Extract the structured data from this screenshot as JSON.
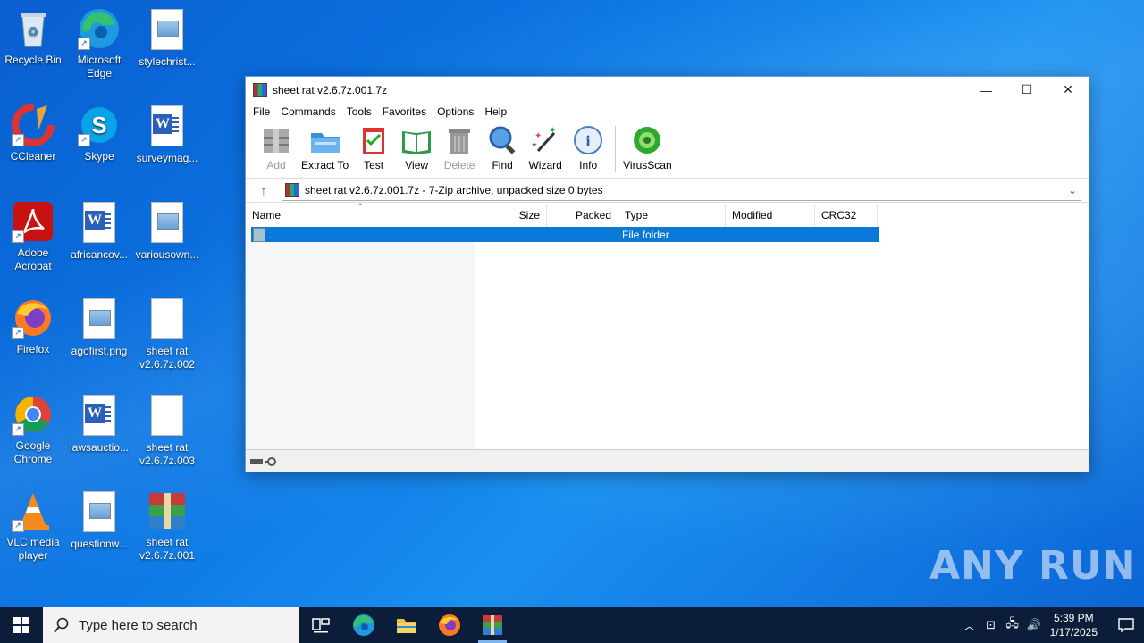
{
  "desktop": {
    "icons": [
      {
        "label": "Recycle Bin"
      },
      {
        "label": "Microsoft Edge"
      },
      {
        "label": "stylechrist..."
      },
      {
        "label": "CCleaner"
      },
      {
        "label": "Skype"
      },
      {
        "label": "surveymag..."
      },
      {
        "label": "Adobe Acrobat"
      },
      {
        "label": "africancov..."
      },
      {
        "label": "variousown..."
      },
      {
        "label": "Firefox"
      },
      {
        "label": "agofirst.png"
      },
      {
        "label": "sheet rat v2.6.7z.002"
      },
      {
        "label": "Google Chrome"
      },
      {
        "label": "lawsauctio..."
      },
      {
        "label": "sheet rat v2.6.7z.003"
      },
      {
        "label": "VLC media player"
      },
      {
        "label": "questionw..."
      },
      {
        "label": "sheet rat v2.6.7z.001"
      }
    ]
  },
  "window": {
    "title": "sheet rat v2.6.7z.001.7z",
    "minimize": "—",
    "maximize": "☐",
    "close": "✕",
    "menu": [
      "File",
      "Commands",
      "Tools",
      "Favorites",
      "Options",
      "Help"
    ],
    "toolbar": [
      {
        "label": "Add",
        "icon": "add-archive-icon",
        "disabled": true
      },
      {
        "label": "Extract To",
        "icon": "extract-folder-icon",
        "disabled": false
      },
      {
        "label": "Test",
        "icon": "test-clipboard-icon",
        "disabled": false
      },
      {
        "label": "View",
        "icon": "view-book-icon",
        "disabled": false
      },
      {
        "label": "Delete",
        "icon": "trash-icon",
        "disabled": true
      },
      {
        "label": "Find",
        "icon": "magnifier-icon",
        "disabled": false
      },
      {
        "label": "Wizard",
        "icon": "wand-icon",
        "disabled": false
      },
      {
        "label": "Info",
        "icon": "info-icon",
        "disabled": false
      },
      {
        "label": "VirusScan",
        "icon": "virus-scan-icon",
        "disabled": false
      }
    ],
    "address": "sheet rat v2.6.7z.001.7z - 7-Zip archive, unpacked size 0 bytes",
    "columns": [
      "Name",
      "Size",
      "Packed",
      "Type",
      "Modified",
      "CRC32"
    ],
    "rows": [
      {
        "name": "..",
        "size": "",
        "packed": "",
        "type": "File folder",
        "modified": "",
        "crc": ""
      }
    ]
  },
  "taskbar": {
    "search_placeholder": "Type here to search",
    "time": "5:39 PM",
    "date": "1/17/2025"
  },
  "watermark": "ANY RUN"
}
